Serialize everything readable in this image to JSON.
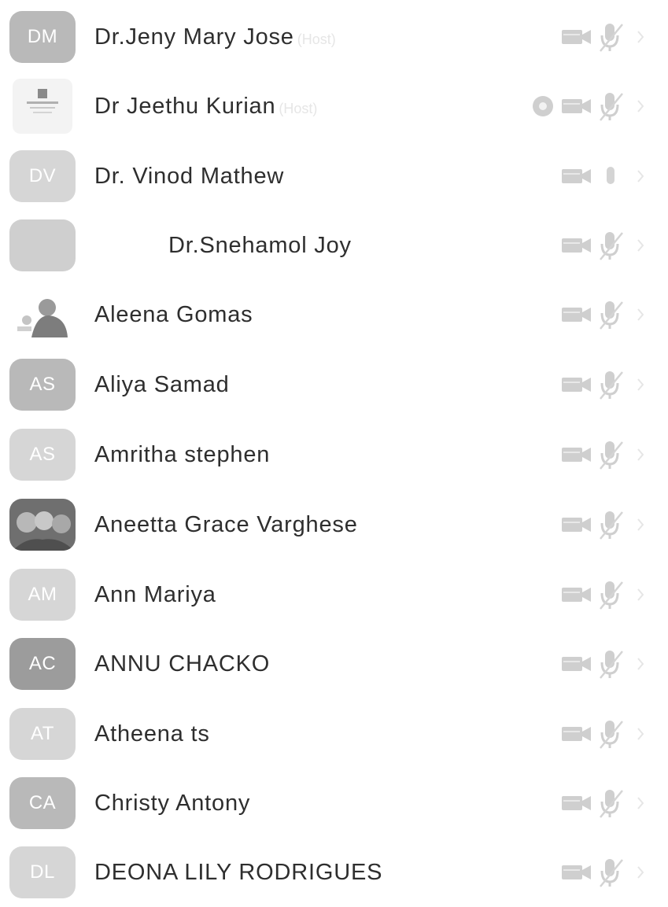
{
  "colors": {
    "icon": "#cfcfcf",
    "avatar_mid": "#b9b9b9",
    "avatar_light": "#d6d6d6",
    "avatar_dark": "#9c9c9c",
    "name_text": "#2e2e2e"
  },
  "participants": [
    {
      "initials": "DM",
      "name": "Dr.Jeny Mary Jose",
      "suffix": "(Host)",
      "recording": false,
      "mic_muted": true
    },
    {
      "initials": "",
      "name": "Dr Jeethu Kurian",
      "suffix": "(Host)",
      "recording": true,
      "mic_muted": true
    },
    {
      "initials": "DV",
      "name": "Dr. Vinod Mathew",
      "suffix": "",
      "recording": false,
      "mic_muted": false
    },
    {
      "initials": "",
      "name": "Dr.Snehamol Joy",
      "suffix": "",
      "recording": false,
      "mic_muted": true
    },
    {
      "initials": "",
      "name": "Aleena Gomas",
      "suffix": "",
      "recording": false,
      "mic_muted": true
    },
    {
      "initials": "AS",
      "name": "Aliya Samad",
      "suffix": "",
      "recording": false,
      "mic_muted": true
    },
    {
      "initials": "AS",
      "name": "Amritha stephen",
      "suffix": "",
      "recording": false,
      "mic_muted": true
    },
    {
      "initials": "",
      "name": "Aneetta Grace Varghese",
      "suffix": "",
      "recording": false,
      "mic_muted": true
    },
    {
      "initials": "AM",
      "name": "Ann Mariya",
      "suffix": "",
      "recording": false,
      "mic_muted": true
    },
    {
      "initials": "AC",
      "name": "ANNU CHACKO",
      "suffix": "",
      "recording": false,
      "mic_muted": true
    },
    {
      "initials": "AT",
      "name": "Atheena ts",
      "suffix": "",
      "recording": false,
      "mic_muted": true
    },
    {
      "initials": "CA",
      "name": "Christy Antony",
      "suffix": "",
      "recording": false,
      "mic_muted": true
    },
    {
      "initials": "DL",
      "name": "DEONA LILY RODRIGUES",
      "suffix": "",
      "recording": false,
      "mic_muted": true
    }
  ],
  "icons": {
    "camera": "video-camera-off-icon",
    "mic_muted": "microphone-muted-icon",
    "mic": "microphone-icon",
    "recording": "recording-icon",
    "more": "chevron-right-icon"
  }
}
